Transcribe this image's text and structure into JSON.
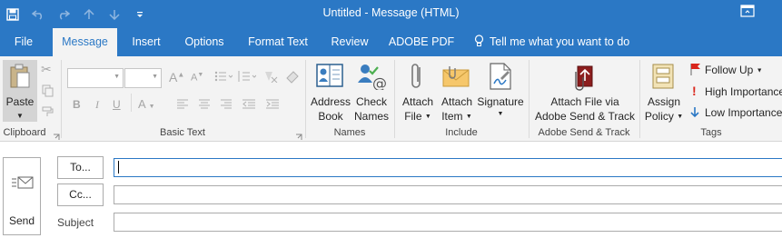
{
  "window": {
    "title": "Untitled - Message (HTML)"
  },
  "qat": {
    "icons": [
      "save-icon",
      "undo-icon",
      "redo-icon",
      "up-arrow-icon",
      "down-arrow-icon",
      "customize-icon"
    ]
  },
  "tabs": [
    {
      "label": "File"
    },
    {
      "label": "Message",
      "active": true
    },
    {
      "label": "Insert"
    },
    {
      "label": "Options"
    },
    {
      "label": "Format Text"
    },
    {
      "label": "Review"
    },
    {
      "label": "ADOBE PDF"
    }
  ],
  "tell_me": "Tell me what you want to do",
  "ribbon": {
    "clipboard": {
      "paste": "Paste",
      "group": "Clipboard"
    },
    "basic_text": {
      "group": "Basic Text",
      "bold": "B",
      "italic": "I",
      "underline": "U",
      "font_color": "A",
      "grow": "A",
      "shrink": "A"
    },
    "names": {
      "address_1": "Address",
      "address_2": "Book",
      "check_1": "Check",
      "check_2": "Names",
      "group": "Names"
    },
    "include": {
      "attach_file_1": "Attach",
      "attach_file_2": "File",
      "attach_item_1": "Attach",
      "attach_item_2": "Item",
      "signature": "Signature",
      "group": "Include"
    },
    "adobe": {
      "line1": "Attach File via",
      "line2": "Adobe Send & Track",
      "group": "Adobe Send & Track"
    },
    "tags": {
      "assign_1": "Assign",
      "assign_2": "Policy",
      "follow_up": "Follow Up",
      "high": "High Importance",
      "low": "Low Importance",
      "group": "Tags"
    }
  },
  "compose": {
    "send": "Send",
    "to": "To...",
    "cc": "Cc...",
    "subject": "Subject",
    "to_value": "",
    "cc_value": "",
    "subject_value": ""
  },
  "colors": {
    "accent": "#2b78c5",
    "ribbon": "#f3f3f3",
    "flag": "#c0392b",
    "high": "#d9261c",
    "low": "#2b78c5"
  }
}
